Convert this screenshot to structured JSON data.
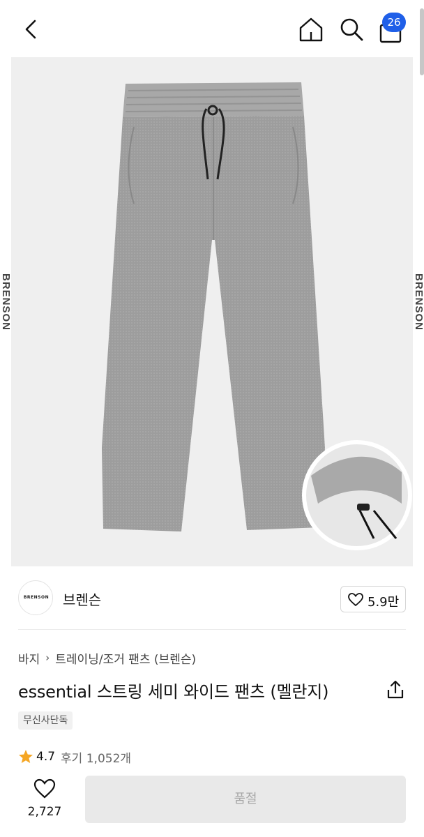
{
  "header": {
    "icons": {
      "back": "chevron-left-icon",
      "home": "home-icon",
      "search": "search-icon",
      "cart": "shopping-bag-icon"
    },
    "cart_count": "26"
  },
  "hero": {
    "side_brand_text": "BRENSON",
    "background_color": "#efefef",
    "product_color": "#9c9c9c"
  },
  "brand": {
    "logo_text": "BRENSON",
    "name": "브렌슨",
    "like_count": "5.9만"
  },
  "breadcrumb": {
    "items": [
      "바지",
      "트레이닝/조거 팬츠 (브렌슨)"
    ]
  },
  "product": {
    "title": "essential 스트링 세미 와이드 팬츠 (멜란지)",
    "exclusive_badge": "무신사단독",
    "rating": "4.7",
    "reviews": "후기 1,052개"
  },
  "bottom_bar": {
    "wish_count": "2,727",
    "action_label": "품절"
  },
  "colors": {
    "accent": "#1f5fe8",
    "star": "#f5a623",
    "disabled_bg": "#e9e9e9",
    "disabled_text": "#a8a8a8"
  }
}
